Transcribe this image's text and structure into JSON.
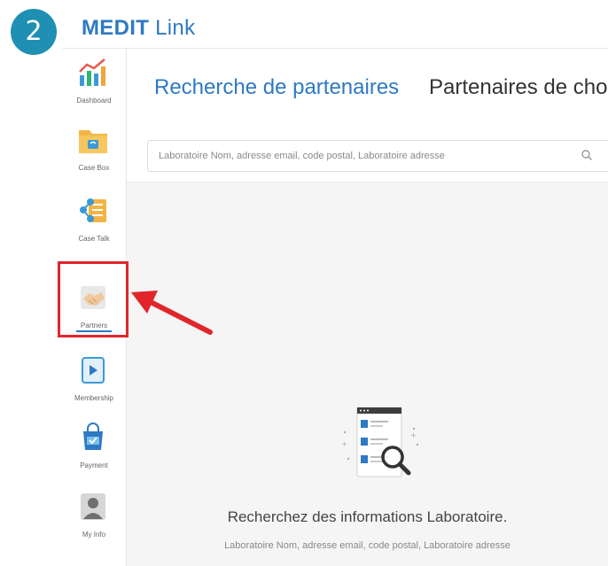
{
  "step": {
    "number": "2"
  },
  "app": {
    "brand_bold": "MEDIT",
    "brand_rest": " Link"
  },
  "sidebar": {
    "items": [
      {
        "label": "Dashboard",
        "icon": "chart-icon"
      },
      {
        "label": "Case Box",
        "icon": "folder-icon"
      },
      {
        "label": "Case Talk",
        "icon": "share-icon"
      },
      {
        "label": "Partners",
        "icon": "handshake-icon",
        "active": true
      },
      {
        "label": "Membership",
        "icon": "play-card-icon"
      },
      {
        "label": "Payment",
        "icon": "shopping-bag-icon"
      },
      {
        "label": "My Info",
        "icon": "user-icon"
      }
    ]
  },
  "tabs": {
    "search": "Recherche de partenaires",
    "chosen": "Partenaires de cho"
  },
  "search": {
    "placeholder": "Laboratoire Nom, adresse email, code postal, Laboratoire adresse"
  },
  "empty_state": {
    "title": "Recherchez des informations Laboratoire.",
    "subtitle": "Laboratoire Nom, adresse email, code postal, Laboratoire adresse"
  },
  "colors": {
    "accent": "#2e79c4",
    "badge": "#1f8fb3",
    "highlight": "#e0262b"
  }
}
